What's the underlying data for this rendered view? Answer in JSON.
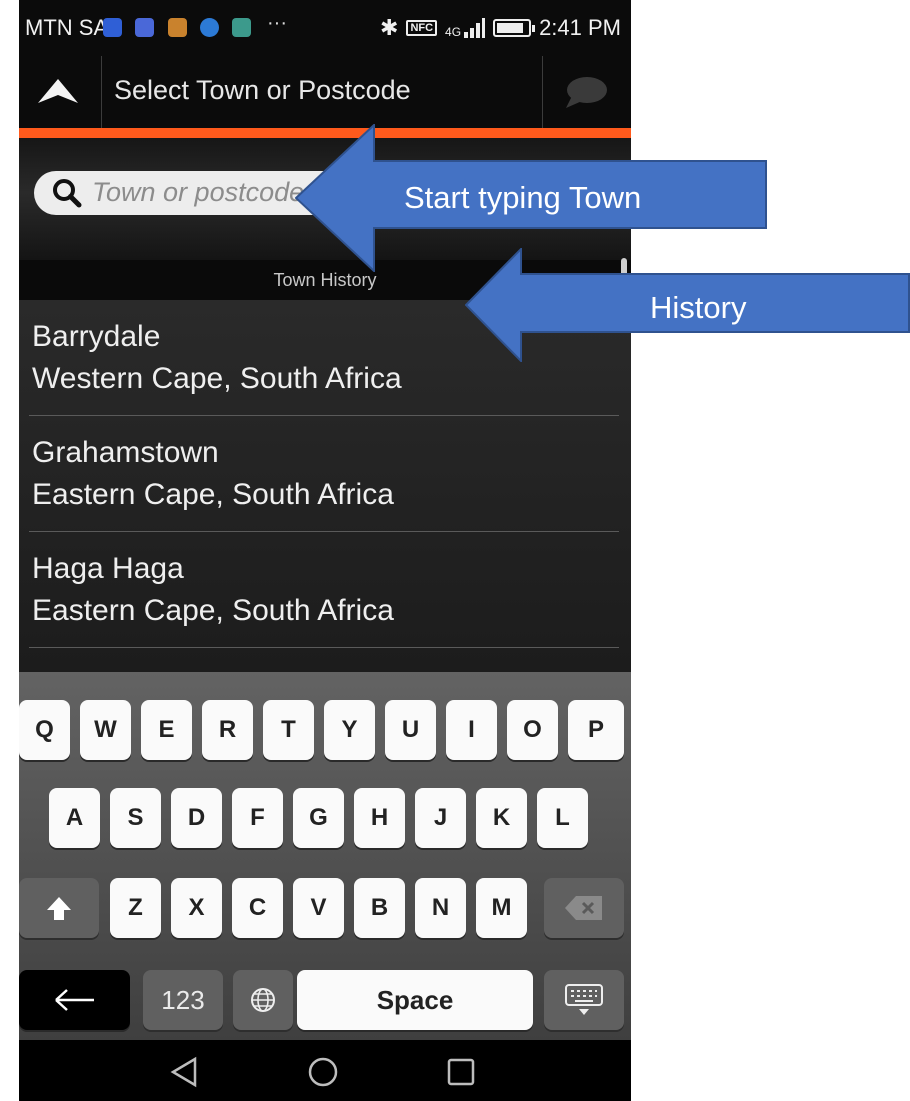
{
  "status_bar": {
    "carrier": "MTN SA",
    "more": "···",
    "nfc": "NFC",
    "network": "4G",
    "time": "2:41 PM",
    "icons": [
      "location-app-icon",
      "app-icon-2",
      "app-icon-3",
      "app-icon-4",
      "gallery-app-icon",
      "bluetooth-icon",
      "nfc-icon",
      "signal-icon",
      "battery-icon"
    ]
  },
  "app_bar": {
    "title": "Select Town or Postcode"
  },
  "search": {
    "placeholder": "Town or postcode"
  },
  "history": {
    "header": "Town History",
    "items": [
      {
        "name": "Barrydale",
        "region": "Western Cape, South Africa"
      },
      {
        "name": "Grahamstown",
        "region": "Eastern Cape, South Africa"
      },
      {
        "name": "Haga Haga",
        "region": "Eastern Cape, South Africa"
      }
    ]
  },
  "keyboard": {
    "row1": [
      "Q",
      "W",
      "E",
      "R",
      "T",
      "Y",
      "U",
      "I",
      "O",
      "P"
    ],
    "row2": [
      "A",
      "S",
      "D",
      "F",
      "G",
      "H",
      "J",
      "K",
      "L"
    ],
    "row3": [
      "Z",
      "X",
      "C",
      "V",
      "B",
      "N",
      "M"
    ],
    "numbers_label": "123",
    "space_label": "Space"
  },
  "annotations": {
    "search_callout": "Start typing Town",
    "history_callout": "History",
    "callout_color": "#4472C4",
    "accent_color": "#FF5A1C"
  }
}
